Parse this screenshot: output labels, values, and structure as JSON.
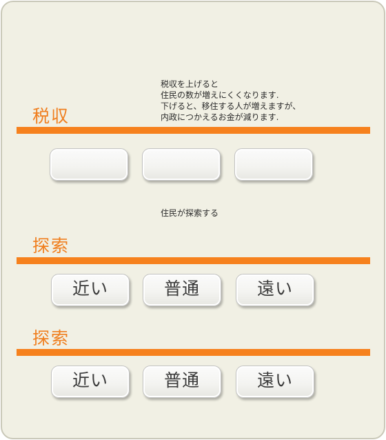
{
  "tax": {
    "title": "税収",
    "description": "税収を上げると\n住民の数が増えにくくなります.\n下げると、移住する人が増えますが、\n内政につかえるお金が減ります.",
    "buttons": [
      {
        "label": ""
      },
      {
        "label": ""
      },
      {
        "label": ""
      }
    ]
  },
  "explore_info": {
    "description": "住民が探索する"
  },
  "explore1": {
    "title": "探索",
    "buttons": [
      {
        "label": "近い"
      },
      {
        "label": "普通"
      },
      {
        "label": "遠い"
      }
    ]
  },
  "explore2": {
    "title": "探索",
    "buttons": [
      {
        "label": "近い"
      },
      {
        "label": "普通"
      },
      {
        "label": "遠い"
      }
    ]
  },
  "colors": {
    "accent": "#f6811d",
    "panel_background": "#f1f0e4"
  }
}
